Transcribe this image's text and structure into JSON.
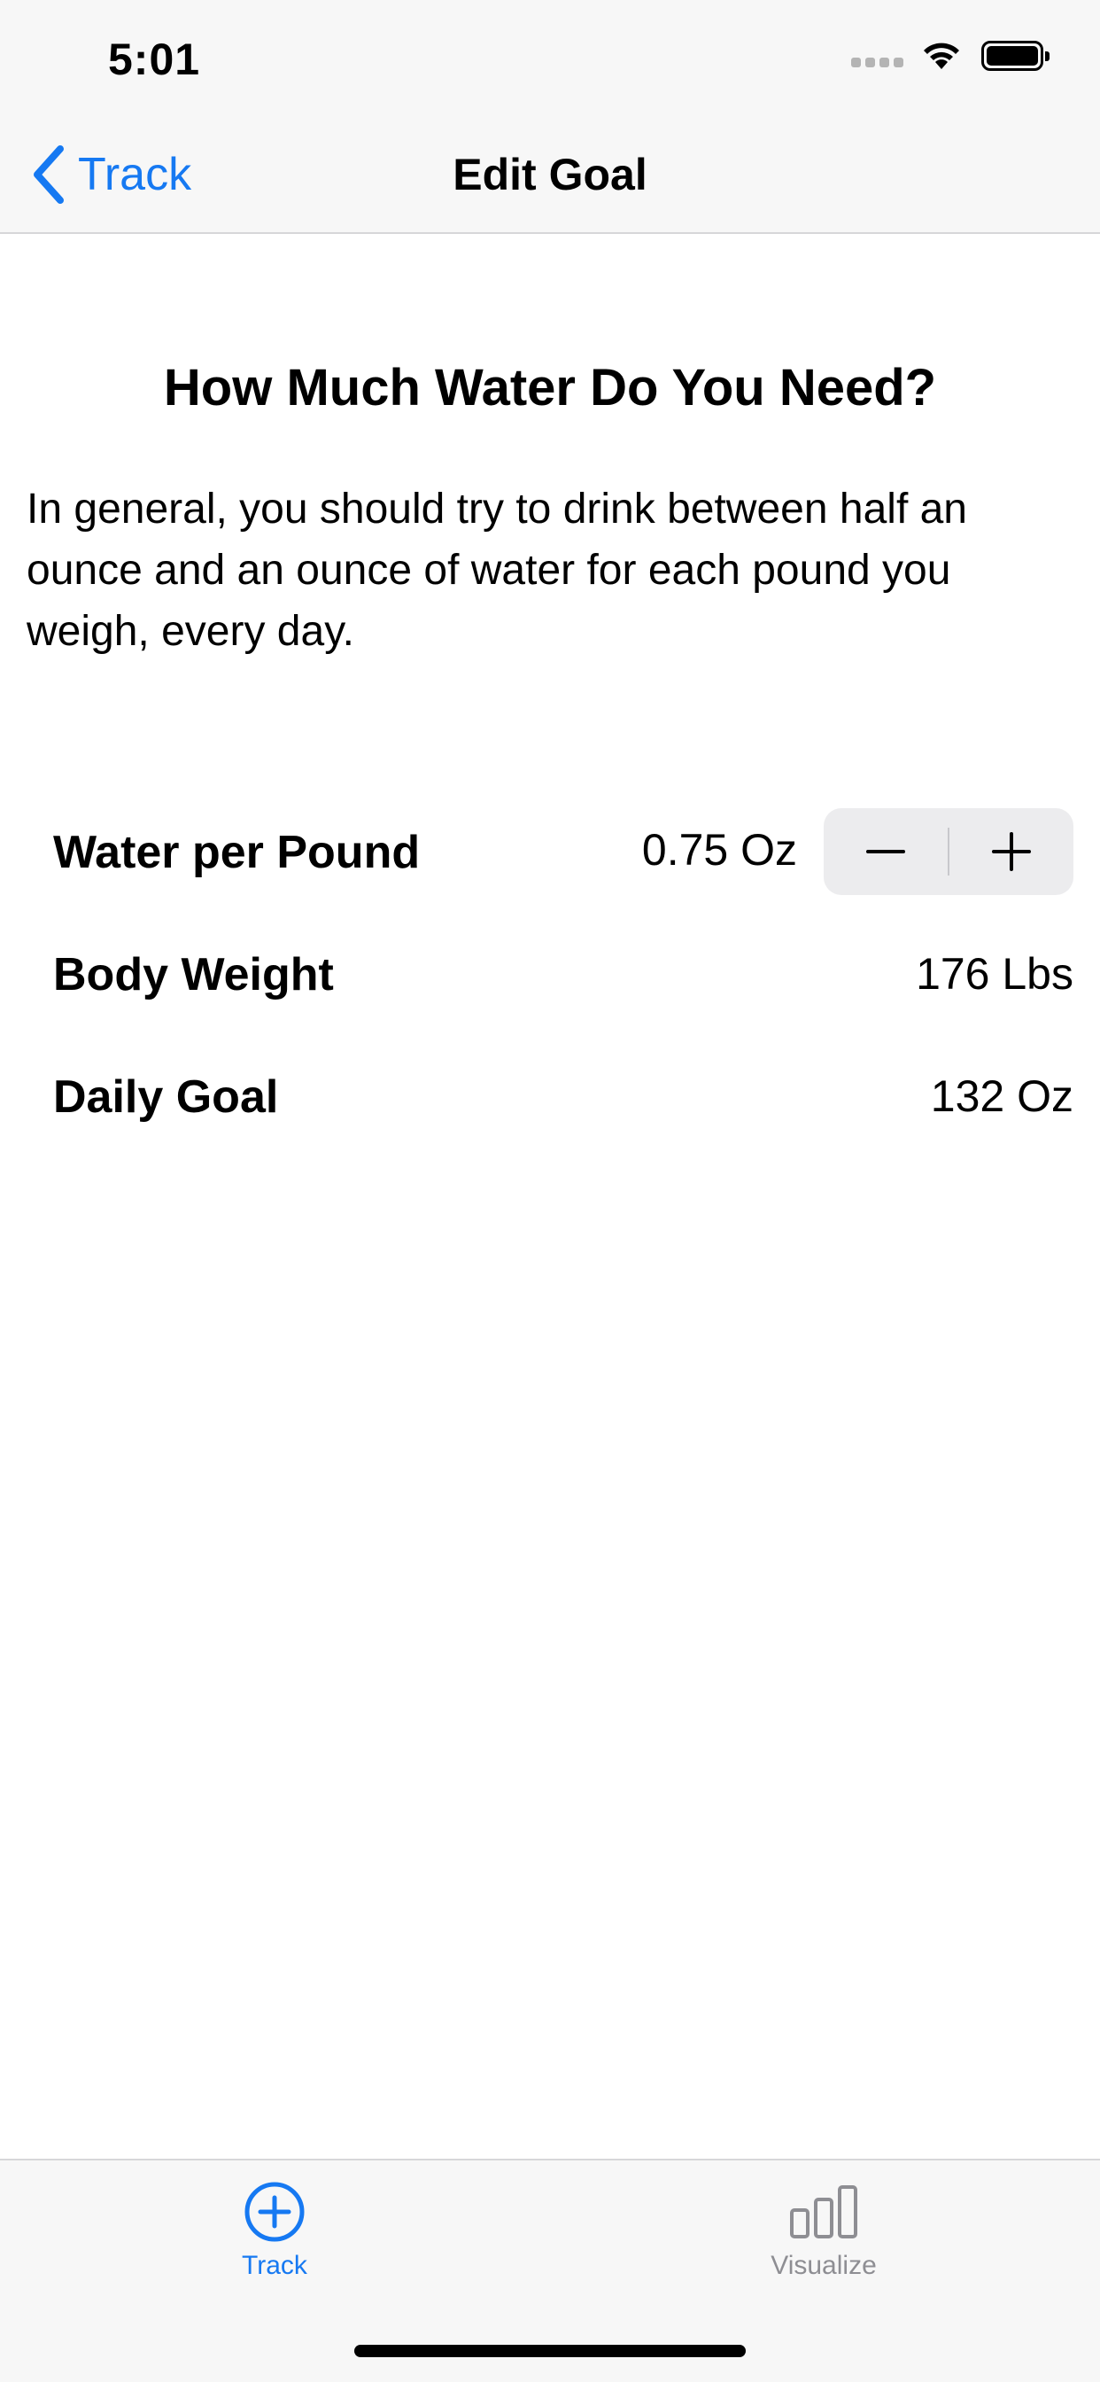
{
  "status_bar": {
    "time": "5:01"
  },
  "nav": {
    "back_label": "Track",
    "title": "Edit Goal"
  },
  "content": {
    "heading": "How Much Water Do You Need?",
    "paragraph": "In general, you should try to drink between half an ounce and an ounce of water for each pound you weigh, every day."
  },
  "settings": {
    "water_per_pound": {
      "label": "Water per Pound",
      "value": "0.75 Oz"
    },
    "body_weight": {
      "label": "Body Weight",
      "value": "176 Lbs"
    },
    "daily_goal": {
      "label": "Daily Goal",
      "value": "132 Oz"
    }
  },
  "tab_bar": {
    "tabs": [
      {
        "label": "Track",
        "icon": "plus-circle-icon",
        "selected": true
      },
      {
        "label": "Visualize",
        "icon": "bar-chart-icon",
        "selected": false
      }
    ]
  },
  "colors": {
    "accent": "#1679f2",
    "inactive": "#8e8e93",
    "bar_background": "#f7f7f7"
  }
}
